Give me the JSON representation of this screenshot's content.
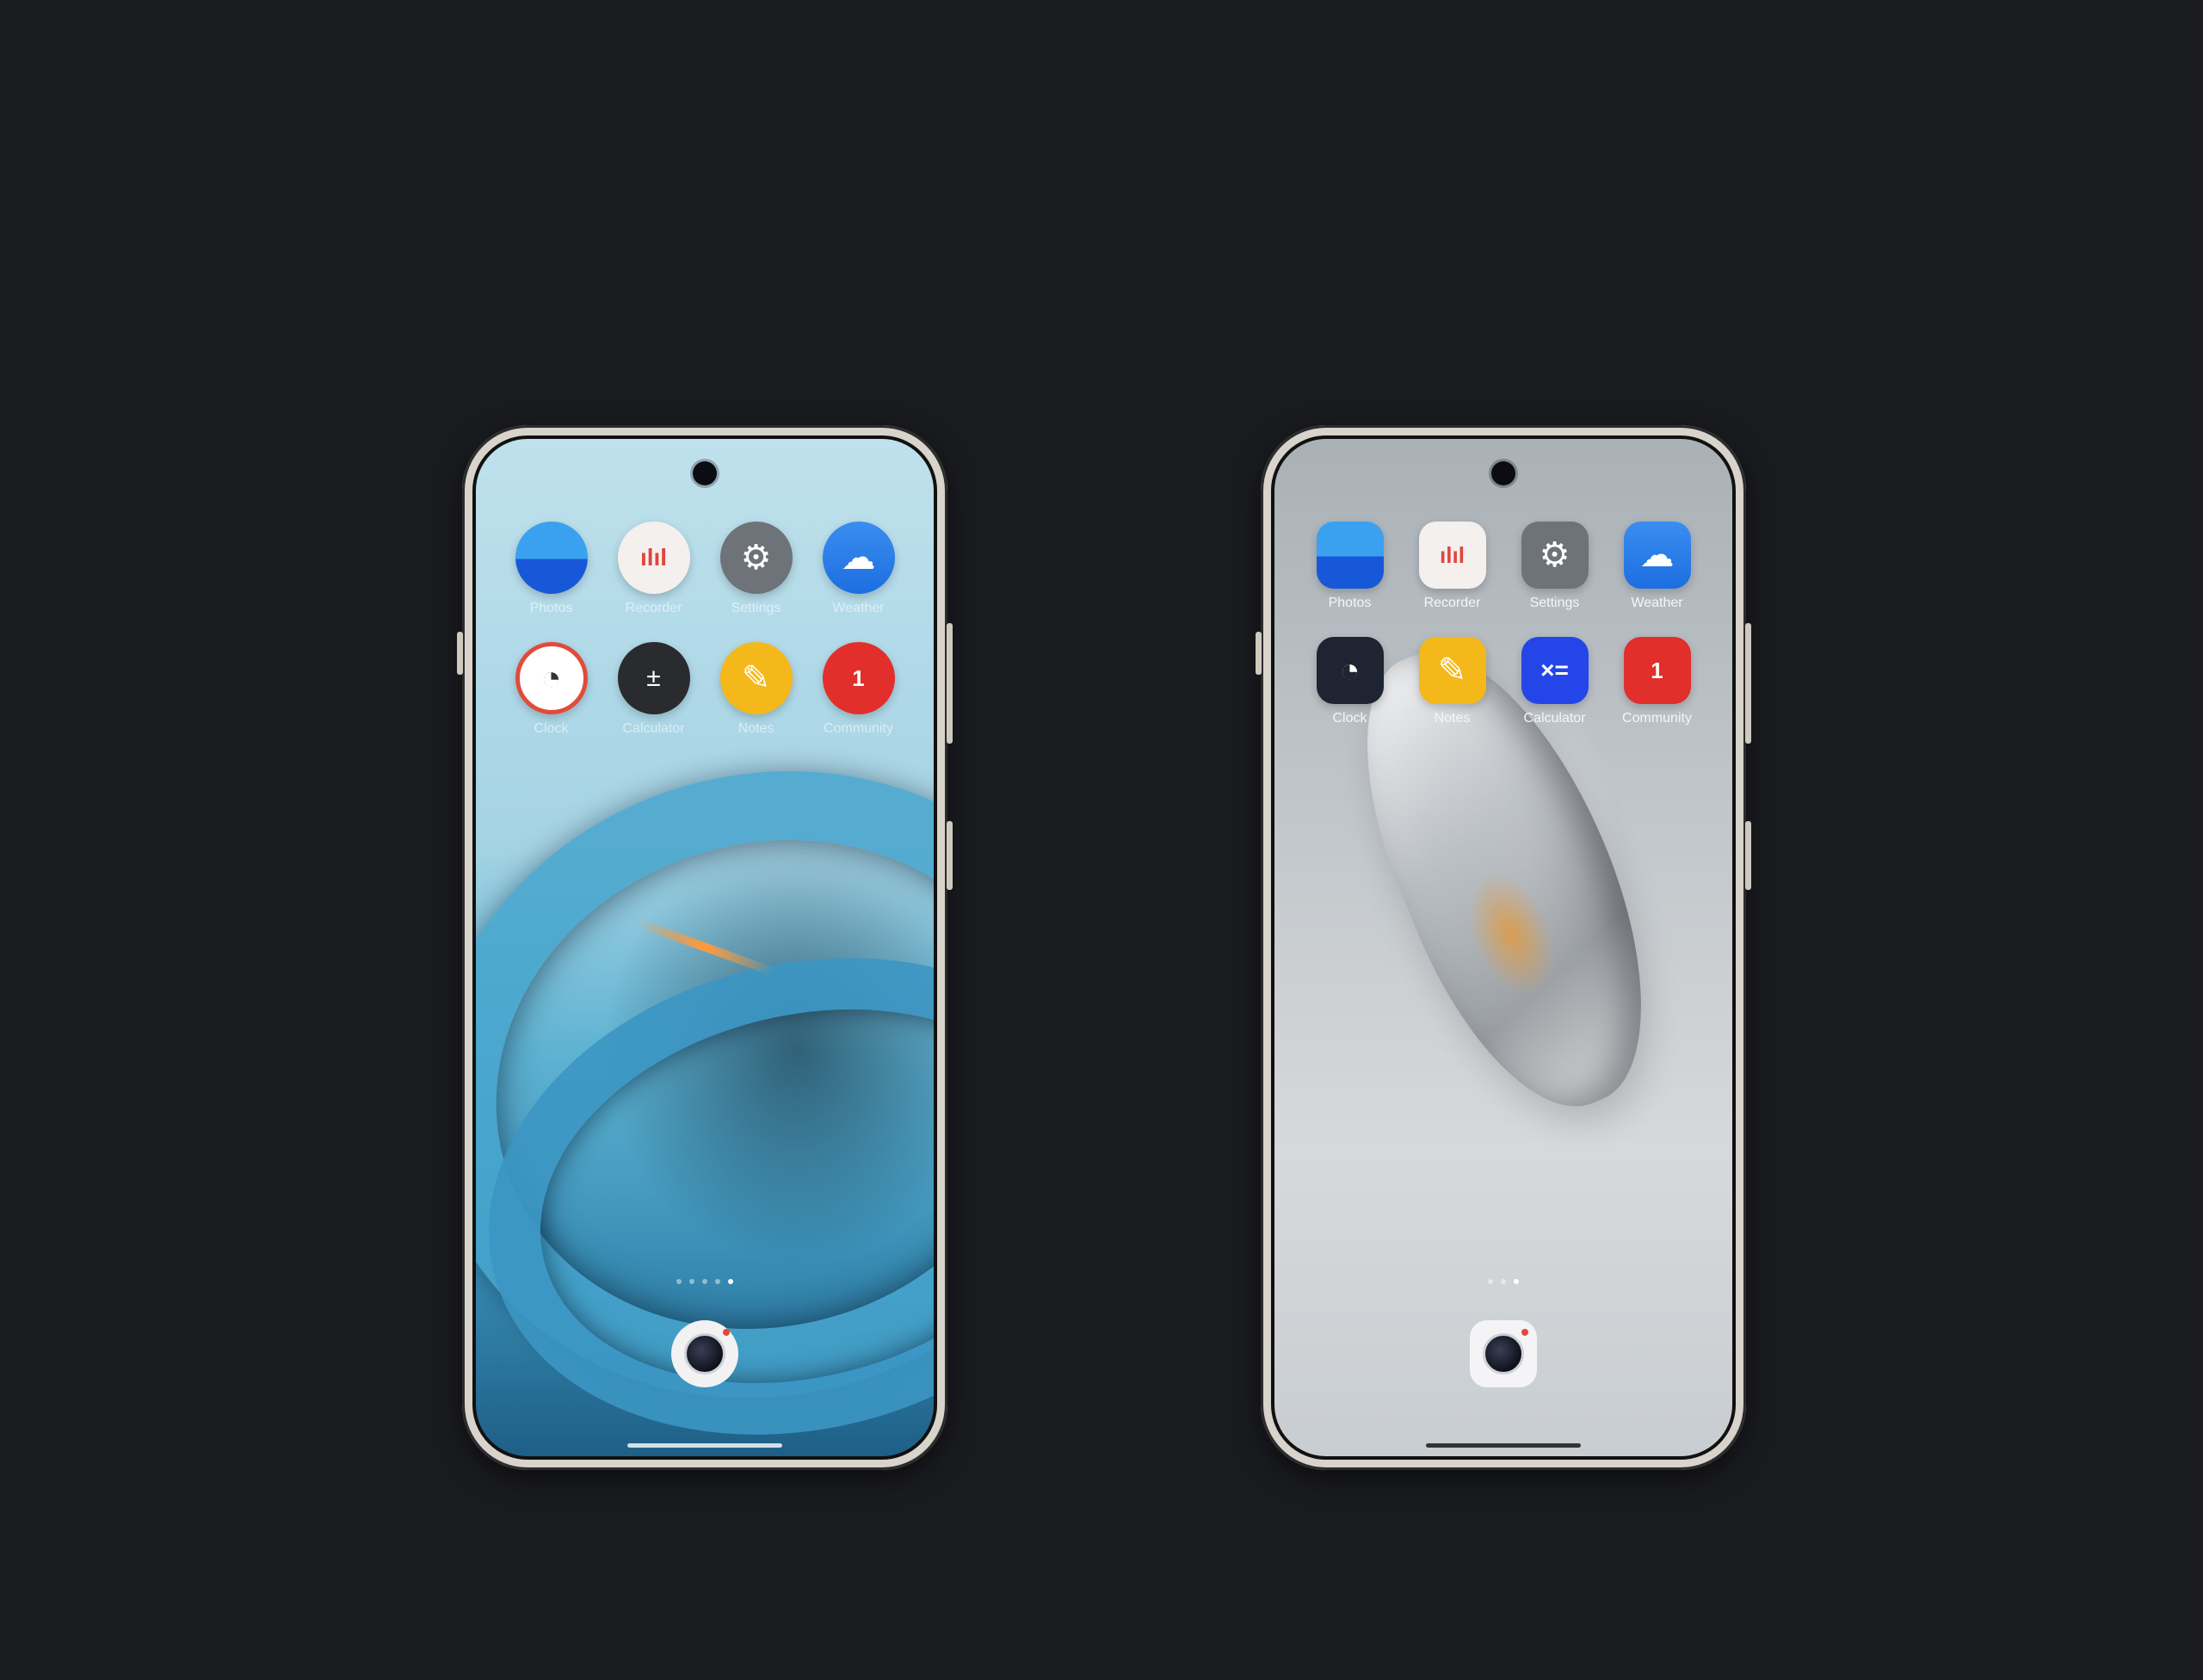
{
  "phones": [
    {
      "id": "left",
      "theme": "round-icons",
      "apps": [
        {
          "label": "Photos",
          "icon": "photos-icon",
          "glyph": "◓"
        },
        {
          "label": "Recorder",
          "icon": "recorder-icon",
          "glyph": "ılıl"
        },
        {
          "label": "Settings",
          "icon": "settings-icon",
          "glyph": "⚙"
        },
        {
          "label": "Weather",
          "icon": "weather-icon",
          "glyph": "☁"
        },
        {
          "label": "Clock",
          "icon": "clock-icon",
          "glyph": "◔"
        },
        {
          "label": "Calculator",
          "icon": "calculator-icon",
          "glyph": "±"
        },
        {
          "label": "Notes",
          "icon": "notes-icon",
          "glyph": "✎"
        },
        {
          "label": "Community",
          "icon": "community-icon",
          "glyph": "1"
        }
      ],
      "page_dots": 5,
      "active_dot": 4
    },
    {
      "id": "right",
      "theme": "squircle-icons",
      "apps": [
        {
          "label": "Photos",
          "icon": "photos-icon",
          "glyph": "◓"
        },
        {
          "label": "Recorder",
          "icon": "recorder-icon",
          "glyph": "ılıl"
        },
        {
          "label": "Settings",
          "icon": "settings-icon",
          "glyph": "⚙"
        },
        {
          "label": "Weather",
          "icon": "weather-icon",
          "glyph": "☁"
        },
        {
          "label": "Clock",
          "icon": "clock-icon",
          "glyph": "◔"
        },
        {
          "label": "Notes",
          "icon": "notes-icon",
          "glyph": "✎"
        },
        {
          "label": "Calculator",
          "icon": "calculator-icon",
          "glyph": "×="
        },
        {
          "label": "Community",
          "icon": "community-icon",
          "glyph": "1"
        }
      ],
      "page_dots": 3,
      "active_dot": 2
    }
  ],
  "colors": {
    "background": "#1a1b1f",
    "accent_red": "#e22f2b",
    "accent_yellow": "#f5b81a",
    "accent_blue": "#1d6ee0"
  }
}
